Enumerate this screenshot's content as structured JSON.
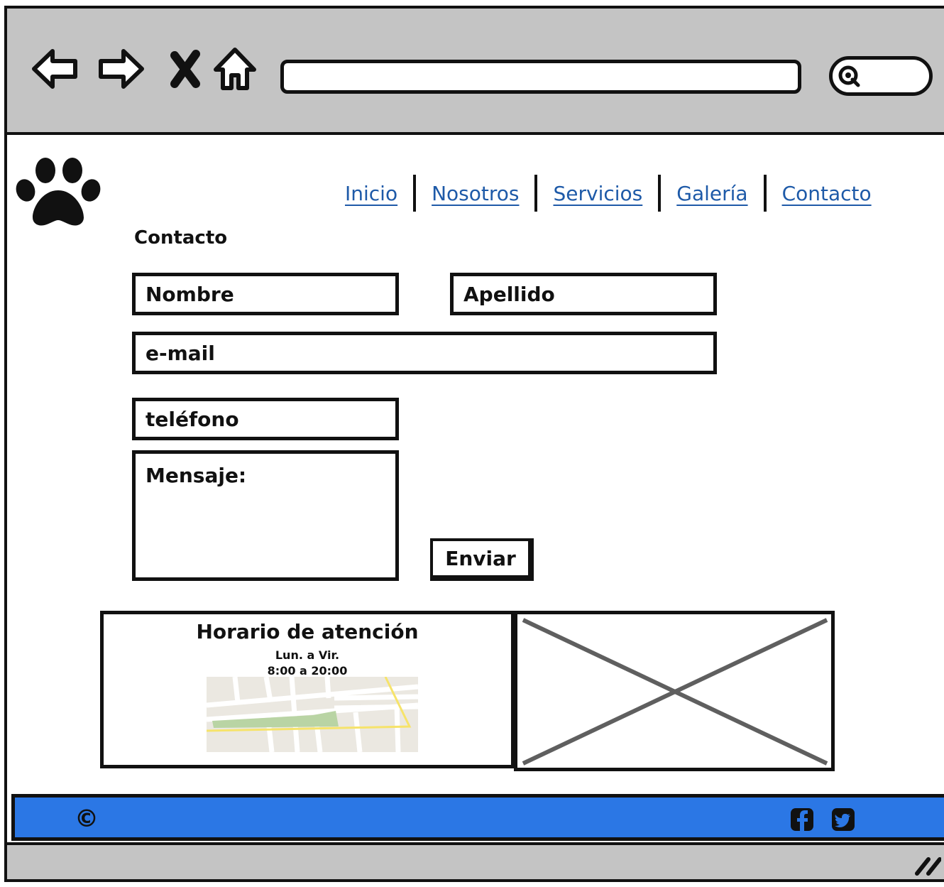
{
  "browser": {
    "back_icon": "arrow-left-icon",
    "forward_icon": "arrow-right-icon",
    "stop_icon": "close-icon",
    "home_icon": "home-icon",
    "address_value": "",
    "search_icon": "search-icon"
  },
  "logo": {
    "icon": "paw-icon"
  },
  "menu": {
    "items": [
      {
        "label": "Inicio"
      },
      {
        "label": "Nosotros"
      },
      {
        "label": "Servicios"
      },
      {
        "label": "Galería"
      },
      {
        "label": "Contacto"
      }
    ]
  },
  "contact": {
    "title": "Contacto",
    "first_name_placeholder": "Nombre",
    "last_name_placeholder": "Apellido",
    "email_placeholder": "e-mail",
    "phone_placeholder": "teléfono",
    "message_placeholder": "Mensaje:",
    "send_label": "Enviar"
  },
  "hours": {
    "title": "Horario de atención",
    "days": "Lun. a Vir.",
    "time": "8:00 a 20:00",
    "map_icon": "map-icon"
  },
  "image_placeholder": {
    "icon": "image-placeholder-icon"
  },
  "footer": {
    "copyright": "©",
    "facebook_icon": "facebook-icon",
    "twitter_icon": "twitter-icon",
    "background": "#2b77e5"
  },
  "colors": {
    "chrome": "#c4c4c4",
    "link": "#1e5aa8"
  }
}
